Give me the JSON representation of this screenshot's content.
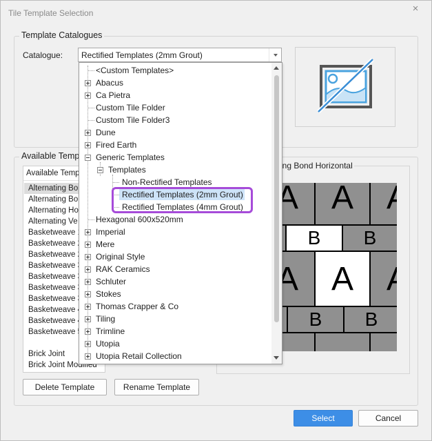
{
  "window": {
    "title": "Tile Template Selection",
    "close_symbol": "×"
  },
  "catalogues_group": {
    "title": "Template Catalogues",
    "catalogue_label": "Catalogue:",
    "catalogue_value": "Rectified Templates (2mm Grout)"
  },
  "available_group": {
    "title": "Available Templ",
    "list_header": "Available Temp",
    "items": [
      "Alternating Bo",
      "Alternating Bo",
      "Alternating Ho",
      "Alternating Ve",
      "Basketweave 1",
      "Basketweave 2",
      "Basketweave 2",
      "Basketweave 3",
      "Basketweave 3",
      "Basketweave 3",
      "Basketweave 3",
      "Basketweave 4",
      "Basketweave 4",
      "Basketweave 5",
      "Brick Joint",
      "Brick Joint Modified"
    ],
    "selected_index": 0
  },
  "preview": {
    "title": "ating Bond Horizontal",
    "letter_a": "A",
    "letter_b": "B"
  },
  "buttons": {
    "delete": "Delete Template",
    "rename": "Rename Template",
    "select": "Select",
    "cancel": "Cancel"
  },
  "dropdown": {
    "items": [
      {
        "label": "<Custom Templates>",
        "level": 0,
        "expander": "none"
      },
      {
        "label": "Abacus",
        "level": 0,
        "expander": "plus"
      },
      {
        "label": "Ca Pietra",
        "level": 0,
        "expander": "plus"
      },
      {
        "label": "Custom Tile Folder",
        "level": 0,
        "expander": "none"
      },
      {
        "label": "Custom Tile Folder3",
        "level": 0,
        "expander": "none"
      },
      {
        "label": "Dune",
        "level": 0,
        "expander": "plus"
      },
      {
        "label": "Fired Earth",
        "level": 0,
        "expander": "plus"
      },
      {
        "label": "Generic Templates",
        "level": 0,
        "expander": "minus"
      },
      {
        "label": "Templates",
        "level": 1,
        "expander": "minus"
      },
      {
        "label": "Non-Rectified Templates",
        "level": 2,
        "expander": "none"
      },
      {
        "label": "Rectified Templates (2mm Grout)",
        "level": 2,
        "expander": "none",
        "selected": true
      },
      {
        "label": "Rectified Templates (4mm Grout)",
        "level": 2,
        "expander": "none"
      },
      {
        "label": "Hexagonal 600x520mm",
        "level": 0,
        "expander": "none"
      },
      {
        "label": "Imperial",
        "level": 0,
        "expander": "plus"
      },
      {
        "label": "Mere",
        "level": 0,
        "expander": "plus"
      },
      {
        "label": "Original Style",
        "level": 0,
        "expander": "plus"
      },
      {
        "label": "RAK Ceramics",
        "level": 0,
        "expander": "plus"
      },
      {
        "label": "Schluter",
        "level": 0,
        "expander": "plus"
      },
      {
        "label": "Stokes",
        "level": 0,
        "expander": "plus"
      },
      {
        "label": "Thomas Crapper & Co",
        "level": 0,
        "expander": "plus"
      },
      {
        "label": "Tiling",
        "level": 0,
        "expander": "plus"
      },
      {
        "label": "Trimline",
        "level": 0,
        "expander": "plus"
      },
      {
        "label": "Utopia",
        "level": 0,
        "expander": "plus"
      },
      {
        "label": "Utopia Retail Collection",
        "level": 0,
        "expander": "plus"
      }
    ]
  },
  "colors": {
    "accent": "#3d8ee6",
    "selection": "#cde3f8",
    "annotation_ring": "#a64bd9",
    "no_image_icon": "#4aa3df"
  },
  "icons": {
    "catalogue_image": "no-image-icon"
  }
}
